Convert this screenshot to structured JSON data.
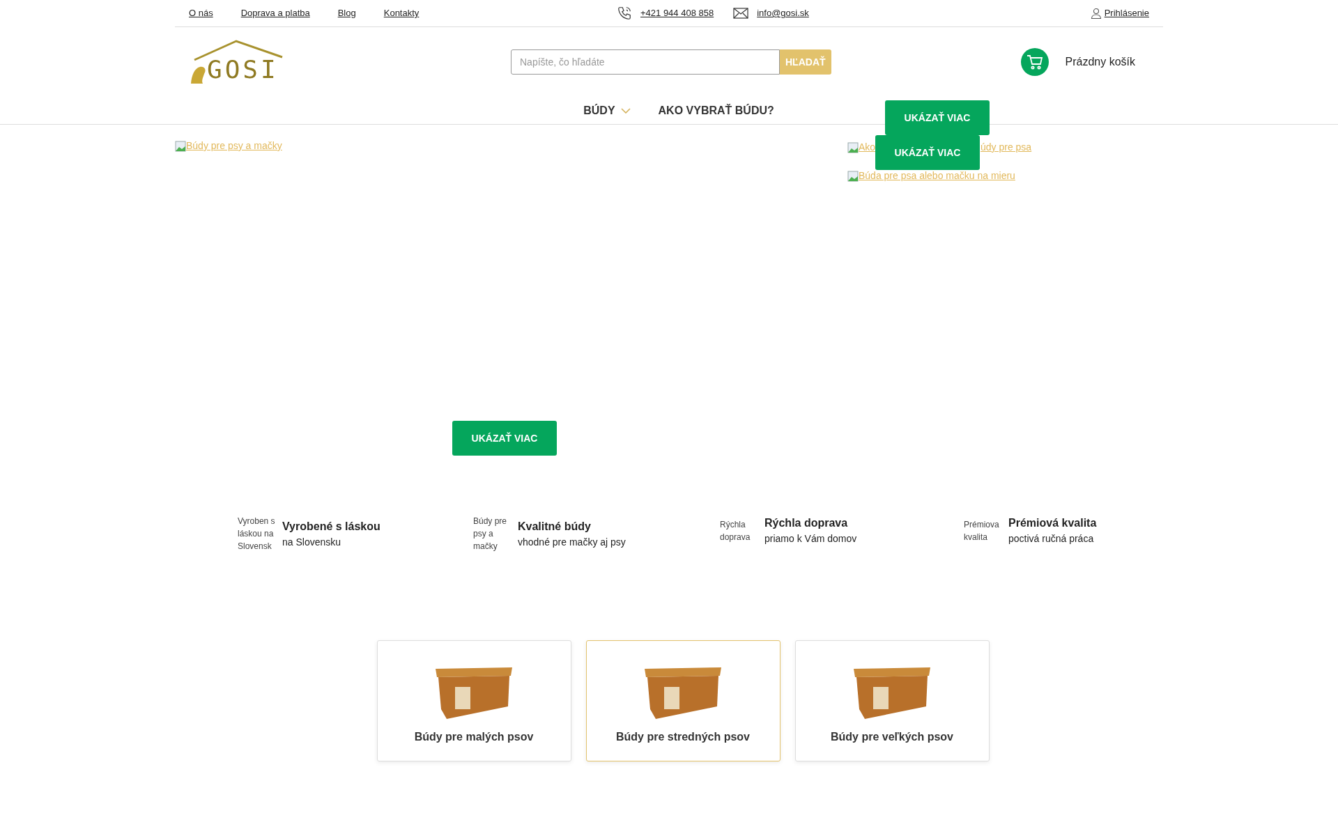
{
  "top_links": [
    "O nás",
    "Doprava a platba",
    "Blog",
    "Kontakty"
  ],
  "contact": {
    "phone": "+421 944 408 858",
    "email": "info@gosi.sk"
  },
  "login": "Prihlásenie",
  "logo": "GOSI",
  "search": {
    "placeholder": "Napíšte, čo hľadáte",
    "button": "HĽADAŤ"
  },
  "cart": "Prázdny košík",
  "nav": [
    {
      "label": "BÚDY",
      "has_dropdown": true
    },
    {
      "label": "AKO VYBRAŤ BÚDU?",
      "has_dropdown": false
    }
  ],
  "banner_main": {
    "image_alt": "Búdy pre psy a mačky",
    "button": "UKÁZAŤ VIAC"
  },
  "banner_side": [
    {
      "image_alt_parts": [
        "Ako",
        "údy pre psa"
      ],
      "button": "UKÁZAŤ VIAC"
    },
    {
      "image_alt_parts": [
        "Búda pre psa alebo mačku na mieru"
      ],
      "button": "UKÁZAŤ VIAC"
    }
  ],
  "features": [
    {
      "image_alt": "Vyroben s láskou na Slovensk",
      "title": "Vyrobené s láskou",
      "subtitle": "na Slovensku"
    },
    {
      "image_alt": "Búdy pre psy a mačky",
      "title": "Kvalitné búdy",
      "subtitle": "vhodné pre mačky aj psy"
    },
    {
      "image_alt": "Rýchla doprava",
      "title": "Rýchla doprava",
      "subtitle": "priamo k Vám domov"
    },
    {
      "image_alt": "Prémiova kvalita",
      "title": "Prémiová kvalita",
      "subtitle": "poctivá ručná práca"
    }
  ],
  "categories": [
    {
      "label": "Búdy pre malých psov",
      "selected": false
    },
    {
      "label": "Búdy pre stredných psov",
      "selected": true
    },
    {
      "label": "Búdy pre veľkých psov",
      "selected": false
    }
  ]
}
